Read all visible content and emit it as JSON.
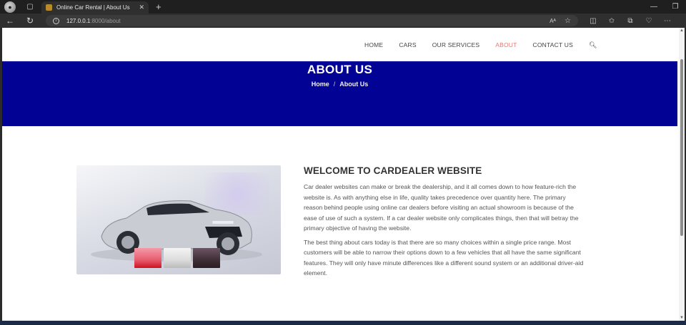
{
  "browser": {
    "tab_title": "Online Car Rental | About Us",
    "url_host": "127.0.0.1",
    "url_path": ":8000/about",
    "read_aloud": "Aᴬ"
  },
  "nav": {
    "items": [
      {
        "label": "HOME"
      },
      {
        "label": "CARS"
      },
      {
        "label": "OUR SERVICES"
      },
      {
        "label": "ABOUT"
      },
      {
        "label": "CONTACT US"
      }
    ],
    "active_color": "#e07a73"
  },
  "hero": {
    "title": "ABOUT US",
    "breadcrumb": [
      "Home",
      "About Us"
    ],
    "separator": "/",
    "bg_color": "#020294"
  },
  "about": {
    "heading": "WELCOME TO CARDEALER WEBSITE",
    "paragraphs": [
      "Car dealer websites can make or break the dealership, and it all comes down to how feature-rich the website is. As with anything else in life, quality takes precedence over quantity here. The primary reason behind people using online car dealers before visiting an actual showroom is because of the ease of use of such a system. If a car dealer website only complicates things, then that will betray the primary objective of having the website.",
      "The best thing about cars today is that there are so many choices within a single price range. Most customers will be able to narrow their options down to a few vehicles that all have the same significant features. They will only have minute differences like a different sound system or an additional driver-aid element."
    ]
  }
}
